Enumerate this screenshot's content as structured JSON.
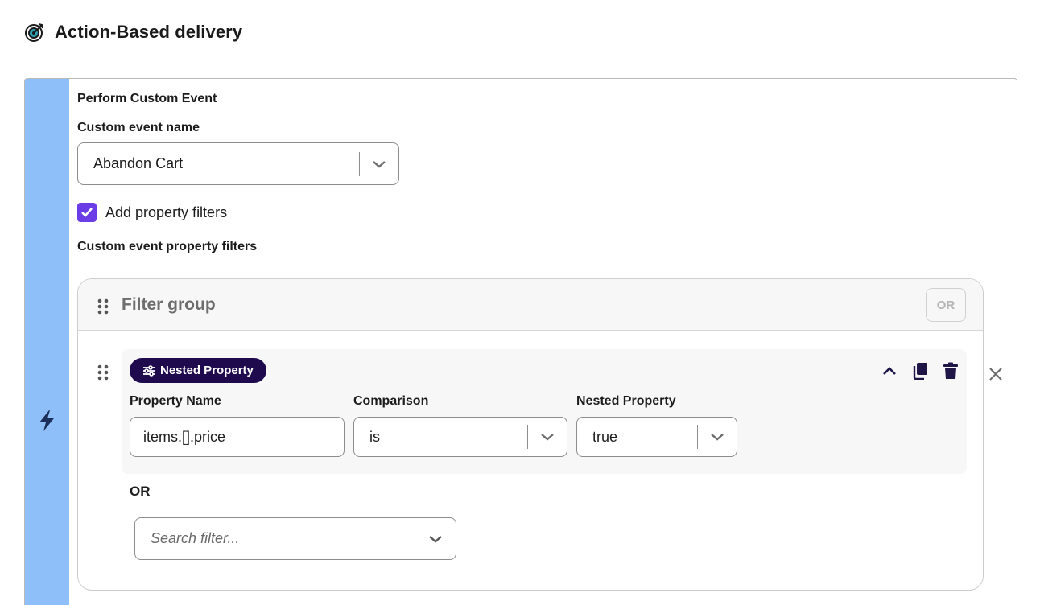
{
  "header": {
    "title": "Action-Based delivery",
    "icon": "target-icon"
  },
  "trigger": {
    "rail_icon": "lightning-bolt-icon",
    "rail_color": "#8fbff9",
    "section_title": "Perform Custom Event",
    "event_name_label": "Custom event name",
    "event_name_value": "Abandon Cart",
    "add_filters_label": "Add property filters",
    "add_filters_checked": true,
    "filters_label": "Custom event property filters"
  },
  "filter_group": {
    "title": "Filter group",
    "or_button": "OR",
    "row": {
      "pill_label": "Nested Property",
      "pill_color": "#1f0a4d",
      "columns": {
        "property_name_label": "Property Name",
        "property_name_value": "items.[].price",
        "comparison_label": "Comparison",
        "comparison_value": "is",
        "nested_label": "Nested Property",
        "nested_value": "true"
      }
    },
    "or_separator": "OR",
    "search_placeholder": "Search filter..."
  },
  "colors": {
    "accent": "#6b3de6",
    "text": "#1c1c1c"
  }
}
